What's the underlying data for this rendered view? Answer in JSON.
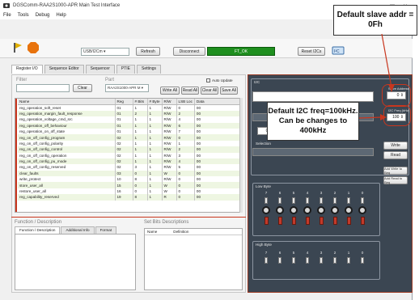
{
  "window": {
    "title": "DGSComm-RAA2S1000-APR Main Test Interface",
    "menu": [
      "File",
      "Tools",
      "Debug",
      "Help"
    ]
  },
  "toolbar": {
    "interface_value": "USB/I2Cm",
    "refresh_label": "Refresh",
    "disconnect_label": "Disconnect",
    "status_text": "FT_OK",
    "reset_label": "Reset I2Cs"
  },
  "tabs": [
    "Register I/O",
    "Sequence Editor",
    "Sequencer",
    "PTIE",
    "Settings"
  ],
  "register_io": {
    "filter_label": "Filter",
    "clear_label": "Clear",
    "part_label": "Part",
    "part_value": "RAA2S1000-APR M",
    "auto_update_label": "Auto Update",
    "write_all_label": "Write All",
    "read_all_label": "Read All",
    "clear_all_label": "Clear All",
    "save_all_label": "Save All",
    "columns": [
      "Name",
      "Reg",
      "# Bits",
      "# Byte",
      "R/W",
      "LSB Loc",
      "Data"
    ],
    "rows": [
      [
        "reg_operation_soft_reset",
        "01",
        "1",
        "1",
        "R/W",
        "0",
        "00"
      ],
      [
        "reg_operation_margin_fault_response",
        "01",
        "2",
        "1",
        "R/W",
        "2",
        "00"
      ],
      [
        "reg_operation_voltage_cmd_src",
        "01",
        "1",
        "1",
        "R/W",
        "4",
        "00"
      ],
      [
        "reg_operation_off_behaviour",
        "01",
        "1",
        "1",
        "R/W",
        "6",
        "00"
      ],
      [
        "reg_operation_on_off_state",
        "01",
        "1",
        "1",
        "R/W",
        "7",
        "00"
      ],
      [
        "reg_on_off_config_program",
        "02",
        "1",
        "1",
        "R/W",
        "0",
        "00"
      ],
      [
        "reg_on_off_config_polarity",
        "02",
        "1",
        "1",
        "R/W",
        "1",
        "00"
      ],
      [
        "reg_on_off_config_control",
        "02",
        "1",
        "1",
        "R/W",
        "2",
        "00"
      ],
      [
        "reg_on_off_config_operation",
        "02",
        "1",
        "1",
        "R/W",
        "3",
        "00"
      ],
      [
        "reg_on_off_config_pu_mode",
        "02",
        "1",
        "1",
        "R/W",
        "4",
        "00"
      ],
      [
        "reg_on_off_config_reserved",
        "02",
        "3",
        "1",
        "R/W",
        "5",
        "00"
      ],
      [
        "clear_faults",
        "03",
        "0",
        "1",
        "W",
        "0",
        "00"
      ],
      [
        "write_protect",
        "10",
        "8",
        "1",
        "R/W",
        "0",
        "00"
      ],
      [
        "store_user_all",
        "15",
        "0",
        "1",
        "W",
        "0",
        "00"
      ],
      [
        "restore_user_all",
        "16",
        "0",
        "1",
        "W",
        "0",
        "00"
      ],
      [
        "reg_capability_reserved",
        "19",
        "8",
        "1",
        "R",
        "0",
        "00"
      ]
    ]
  },
  "lower_left": {
    "function_title": "Function / Description",
    "subtabs": [
      "Function / Description",
      "Additional Info",
      "Format"
    ],
    "bitfield_title": "Set Bits Descriptions",
    "bitfield_columns": [
      "Name",
      "Definition"
    ]
  },
  "right_panel": {
    "group_title": "I2C",
    "slave_addr_label": "Slave Address",
    "slave_addr_value": "0",
    "freq_label": "I2C Freq (kHz)",
    "freq_value": "100",
    "spin_a": "0",
    "spin_b": "0",
    "write_label": "Write",
    "read_label": "Read",
    "selection_label": "Selection",
    "add_write_label": "Add Write to Seq",
    "add_read_label": "Add Read to Seq",
    "low_byte_label": "Low Byte",
    "high_byte_label": "High Byte",
    "bit_numbers": [
      "7",
      "6",
      "5",
      "4",
      "3",
      "2",
      "1",
      "0"
    ]
  },
  "callouts": {
    "slave": "Default slave addr = 0Fh",
    "freq": "Default I2C freq=100kHz. Can be changes to 400kHz"
  },
  "colors": {
    "accent_red": "#c8361e",
    "status_green": "#1f8f1f",
    "dark_panel": "#3b4652"
  },
  "icons": [
    "app-icon",
    "minimize-icon",
    "maximize-icon",
    "close-icon",
    "flag-icon",
    "stop-icon",
    "connect-icon"
  ]
}
